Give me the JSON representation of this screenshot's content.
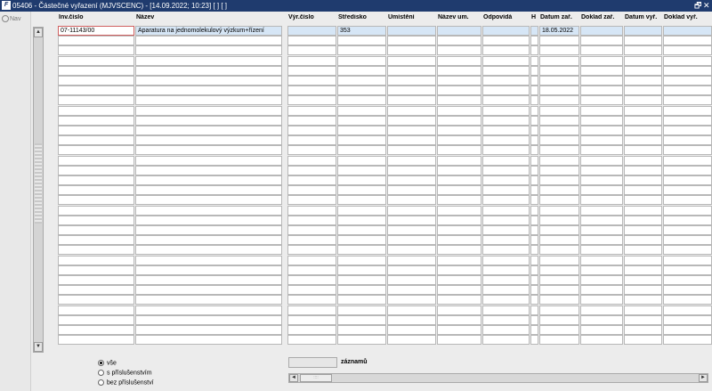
{
  "window": {
    "app_icon": "F",
    "title": "05406 - Částečné vyřazení (MJVSCENC) - [14.09.2022; 10:23]  [ ]  [ ]",
    "restore_glyph": "🗗",
    "close_glyph": "✕"
  },
  "nav": {
    "label": "Nav",
    "icon": "nav-icon"
  },
  "columns": [
    {
      "key": "inv",
      "label": "Inv.číslo"
    },
    {
      "key": "nazev",
      "label": "Název"
    },
    {
      "key": "vyr",
      "label": "Výr.číslo"
    },
    {
      "key": "stredisko",
      "label": "Středisko"
    },
    {
      "key": "umisteni",
      "label": "Umístění"
    },
    {
      "key": "nazev_um",
      "label": "Název um."
    },
    {
      "key": "odpovida",
      "label": "Odpovídá"
    },
    {
      "key": "h",
      "label": "H"
    },
    {
      "key": "datum_zar",
      "label": "Datum zař."
    },
    {
      "key": "doklad_zar",
      "label": "Doklad zař."
    },
    {
      "key": "datum_vyr",
      "label": "Datum vyř."
    },
    {
      "key": "doklad_vyr",
      "label": "Doklad vyř."
    }
  ],
  "rows": [
    {
      "inv": "07-11143/00",
      "nazev": "Aparatura na jednomolekulový výzkum+řízení",
      "vyr": "",
      "stredisko": "353",
      "umisteni": "",
      "nazev_um": "",
      "odpovida": "",
      "h": "",
      "datum_zar": "18.05.2022",
      "doklad_zar": "",
      "datum_vyr": "",
      "doklad_vyr": ""
    }
  ],
  "empty_row_count": 31,
  "scrollbar": {
    "up": "▲",
    "down": "▼",
    "left": "◄",
    "right": "►",
    "grip": "::::"
  },
  "filter": {
    "options": [
      {
        "label": "vše",
        "selected": true
      },
      {
        "label": "s příslušenstvím",
        "selected": false
      },
      {
        "label": "bez příslušenství",
        "selected": false
      }
    ]
  },
  "records": {
    "label": "záznamů",
    "value": ""
  }
}
